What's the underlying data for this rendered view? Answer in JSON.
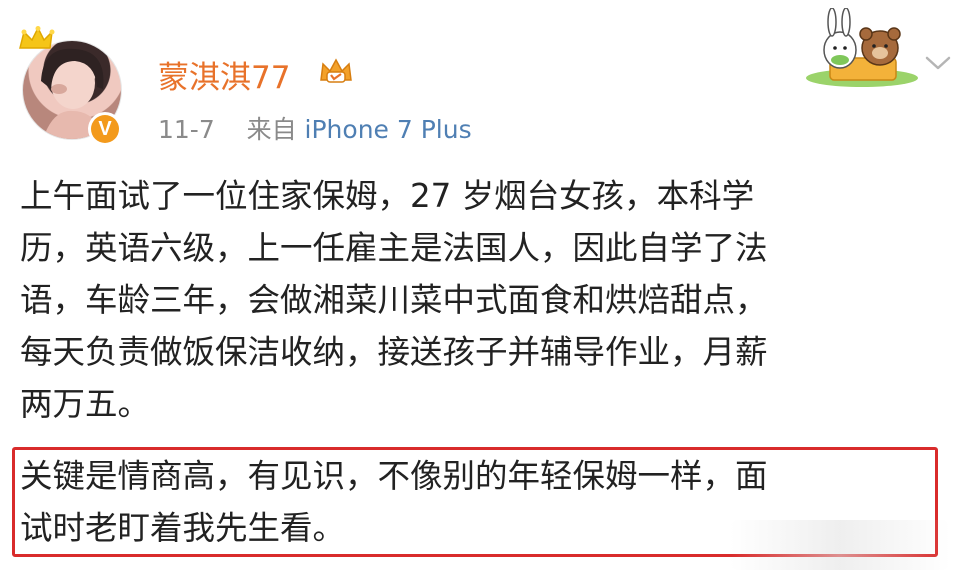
{
  "post": {
    "username": "蒙淇淇77",
    "date": "11-7",
    "source_prefix": "来自",
    "device": "iPhone 7 Plus",
    "body_lines": [
      "上午面试了一位住家保姆，27 岁烟台女孩，本科学",
      "历，英语六级，上一任雇主是法国人，因此自学了法",
      "语，车龄三年，会做湘菜川菜中式面食和烘焙甜点，",
      "每天负责做饭保洁收纳，接送孩子并辅导作业，月薪",
      "两万五。"
    ],
    "highlight_lines": [
      "关键是情商高，有见识，不像别的年轻保姆一样，面",
      "试时老盯着我先生看。"
    ]
  },
  "icons": {
    "avatar_crown": "crown-icon",
    "verified": "verified-v-icon",
    "vip_badge": "vip-crown-badge-icon",
    "sticker": "bunny-bear-sticker",
    "menu": "chevron-down-icon"
  },
  "badges": {
    "verified_letter": "V"
  },
  "colors": {
    "username": "#e8722a",
    "meta": "#8a8a8a",
    "device_link": "#4f7fb3",
    "highlight_border": "#d92b2b",
    "verified": "#f39a1c"
  }
}
